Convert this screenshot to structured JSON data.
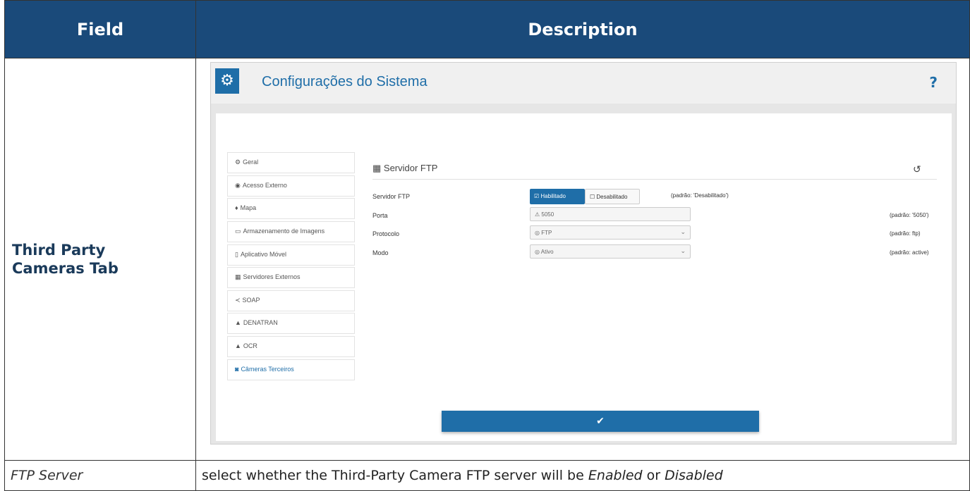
{
  "table": {
    "header_field": "Field",
    "header_description": "Description",
    "row1_field_line1": "Third Party",
    "row1_field_line2": "Cameras Tab",
    "row2_field": "FTP Server",
    "row2_desc_prefix": "select whether the Third-Party Camera FTP server will be ",
    "row2_desc_enabled": "Enabled",
    "row2_desc_or": " or ",
    "row2_desc_disabled": "Disabled"
  },
  "screenshot": {
    "title": "Configurações do Sistema",
    "help": "?",
    "sidebar": [
      {
        "icon": "gears-icon",
        "glyph": "⚙",
        "label": "Geral"
      },
      {
        "icon": "globe-icon",
        "glyph": "◉",
        "label": "Acesso Externo"
      },
      {
        "icon": "map-pin-icon",
        "glyph": "♦",
        "label": "Mapa"
      },
      {
        "icon": "hdd-icon",
        "glyph": "▭",
        "label": "Armazenamento de Imagens"
      },
      {
        "icon": "mobile-icon",
        "glyph": "▯",
        "label": "Aplicativo Móvel"
      },
      {
        "icon": "server-icon",
        "glyph": "▦",
        "label": "Servidores Externos"
      },
      {
        "icon": "soap-icon",
        "glyph": "≺",
        "label": "SOAP"
      },
      {
        "icon": "car-icon",
        "glyph": "▲",
        "label": "DENATRAN"
      },
      {
        "icon": "car-icon",
        "glyph": "▲",
        "label": "OCR"
      },
      {
        "icon": "camera-icon",
        "glyph": "◙",
        "label": "Câmeras Terceiros"
      }
    ],
    "active_sidebar_index": 9,
    "section_title": "Servidor FTP",
    "form": {
      "ftp_label": "Servidor FTP",
      "enabled_btn": "Habilitado",
      "disabled_btn": "Desabilitado",
      "ftp_hint": "(padrão: 'Desabilitado')",
      "port_label": "Porta",
      "port_value": "5050",
      "port_hint": "(padrão: '5050')",
      "protocol_label": "Protocolo",
      "protocol_value": "FTP",
      "protocol_hint": "(padrão: ftp)",
      "mode_label": "Modo",
      "mode_value": "Ativo",
      "mode_hint": "(padrão: active)"
    },
    "submit_glyph": "✔"
  },
  "colors": {
    "header_bg": "#1a4a7a",
    "accent": "#1f6ea8"
  }
}
